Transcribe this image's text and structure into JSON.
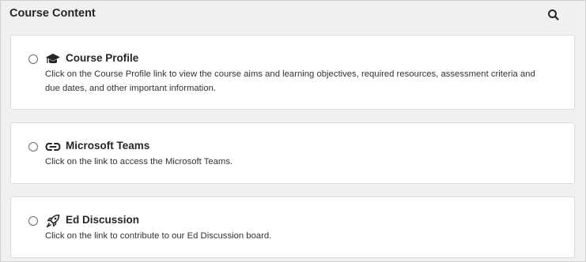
{
  "header": {
    "title": "Course Content",
    "search_icon": "search-icon"
  },
  "items": [
    {
      "title": "Course Profile",
      "icon": "graduation-cap-icon",
      "description": "Click on the Course Profile link to view the course aims and learning objectives, required resources, assessment criteria and due dates, and other important information."
    },
    {
      "title": "Microsoft Teams",
      "icon": "link-icon",
      "description": "Click on the link to access the Microsoft Teams."
    },
    {
      "title": "Ed Discussion",
      "icon": "rocket-icon",
      "description": "Click on the link to contribute to our Ed Discussion board."
    }
  ]
}
